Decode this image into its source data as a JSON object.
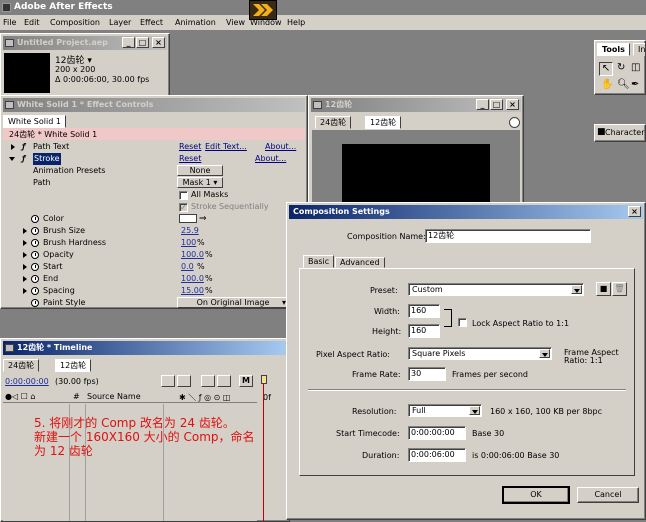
{
  "app": {
    "title": "Adobe After Effects",
    "menu": [
      "File",
      "Edit",
      "Composition",
      "Layer",
      "Effect",
      "Animation",
      "View",
      "Window",
      "Help"
    ]
  },
  "project": {
    "title": "Untitled Project.aep",
    "item_name": "12齿轮 ▾",
    "dims": "200 x 200",
    "duration": "Δ 0:00:06:00, 30.00 fps"
  },
  "tools": {
    "title": "Tools",
    "tab2": "In",
    "character_label": "Character"
  },
  "effect_controls": {
    "title": "White Solid 1 * Effect Controls",
    "tab": "White Solid 1",
    "header": "24齿轮 * White Solid 1",
    "path_text": {
      "label": "Path Text",
      "reset": "Reset",
      "edit": "Edit Text...",
      "about": "About..."
    },
    "stroke": {
      "label": "Stroke",
      "reset": "Reset",
      "about": "About..."
    },
    "anim_presets": {
      "label": "Animation Presets",
      "value": "None"
    },
    "path": {
      "label": "Path",
      "value": "Mask 1"
    },
    "all_masks": "All Masks",
    "stroke_seq": "Stroke Sequentially",
    "props": [
      {
        "label": "Color",
        "value": ""
      },
      {
        "label": "Brush Size",
        "value": "25.9",
        "unit": ""
      },
      {
        "label": "Brush Hardness",
        "value": "100",
        "unit": "%"
      },
      {
        "label": "Opacity",
        "value": "100.0",
        "unit": "%"
      },
      {
        "label": "Start",
        "value": "0.0",
        "unit": "%"
      },
      {
        "label": "End",
        "value": "100.0",
        "unit": "%"
      },
      {
        "label": "Spacing",
        "value": "15.00",
        "unit": "%"
      }
    ],
    "paint_style": {
      "label": "Paint Style",
      "value": "On Original Image"
    }
  },
  "comp_viewer": {
    "title": "12齿轮",
    "tabs": [
      "24齿轮",
      "12齿轮"
    ]
  },
  "timeline": {
    "title": "12齿轮 * Timeline",
    "tabs": [
      "24齿轮",
      "12齿轮"
    ],
    "time": "0:00:00:00",
    "fps": "(30.00 fps)",
    "col_num": "#",
    "col_source": "Source Name",
    "ruler_mark": "0f"
  },
  "annotation": {
    "lines": [
      "5. 将刚才的 Comp 改名为 24 齿轮。",
      "新建一个 160X160 大小的 Comp，命名",
      "为 12 齿轮"
    ]
  },
  "dialog": {
    "title": "Composition Settings",
    "comp_name_label": "Composition Name:",
    "comp_name": "12齿轮",
    "tabs": [
      "Basic",
      "Advanced"
    ],
    "preset_label": "Preset:",
    "preset": "Custom",
    "width_label": "Width:",
    "width": "160",
    "height_label": "Height:",
    "height": "160",
    "lock_label": "Lock Aspect Ratio to 1:1",
    "par_label": "Pixel Aspect Ratio:",
    "par": "Square Pixels",
    "far_label1": "Frame Aspect",
    "far_label2": "Ratio: 1:1",
    "frame_rate_label": "Frame Rate:",
    "frame_rate": "30",
    "fps_unit": "Frames per second",
    "resolution_label": "Resolution:",
    "resolution": "Full",
    "resolution_info": "160 x 160, 100 KB per 8bpc",
    "start_tc_label": "Start Timecode:",
    "start_tc": "0:00:00:00",
    "start_tc_info": "Base 30",
    "duration_label": "Duration:",
    "duration": "0:00:06:00",
    "duration_info": "is 0:00:06:00  Base 30",
    "ok": "OK",
    "cancel": "Cancel"
  }
}
